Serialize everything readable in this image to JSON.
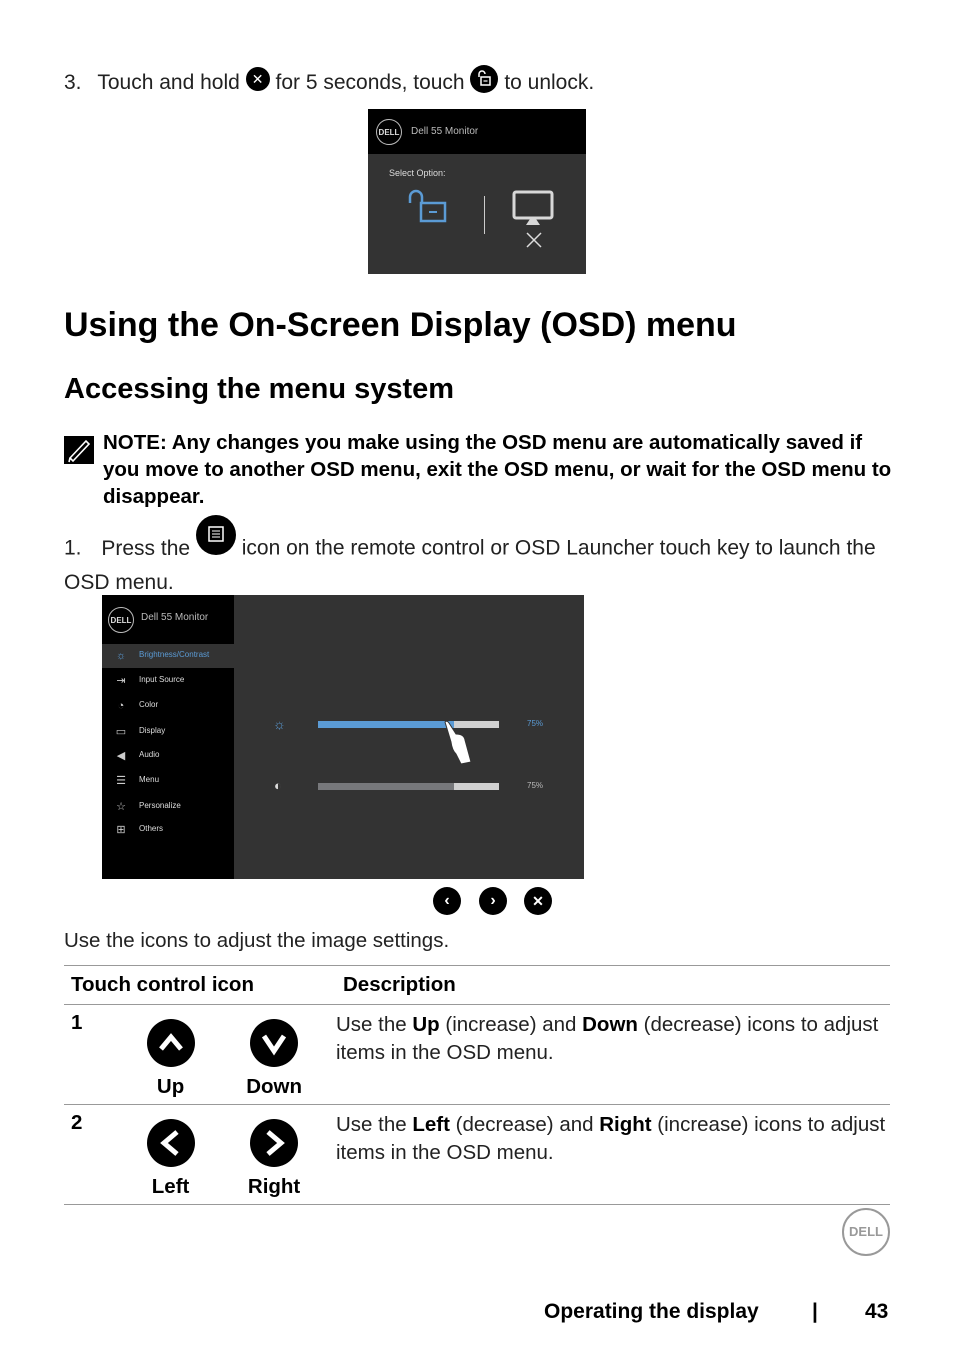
{
  "step3": {
    "number": "3.",
    "text_before": "Touch and hold",
    "text_middle": "for 5 seconds, touch",
    "text_after": "to unlock.",
    "icon1": "close-icon",
    "icon2": "unlock-icon"
  },
  "lock_dialog": {
    "logo": "DELL",
    "title": "Dell 55 Monitor",
    "prompt": "Select Option:",
    "options": [
      "unlock-icon",
      "monitor-settings-icon"
    ]
  },
  "headings": {
    "h1": "Using the On-Screen Display (OSD) menu",
    "h2": "Accessing the menu system"
  },
  "note": {
    "icon": "pencil-note-icon",
    "text": "NOTE: Any changes you make using the OSD menu are automatically saved if you move to another OSD menu, exit the OSD menu, or wait for the OSD menu to disappear."
  },
  "step1": {
    "number": "1.",
    "text_before": "Press the",
    "text_after": "icon on the remote control or OSD Launcher touch key to launch the OSD menu.",
    "icon": "menu-icon"
  },
  "osd_menu": {
    "logo": "DELL",
    "title": "Dell 55 Monitor",
    "items": [
      {
        "label": "Brightness/Contrast",
        "icon": "brightness-icon",
        "active": true
      },
      {
        "label": "Input Source",
        "icon": "input-source-icon",
        "active": false
      },
      {
        "label": "Color",
        "icon": "color-palette-icon",
        "active": false
      },
      {
        "label": "Display",
        "icon": "display-icon",
        "active": false
      },
      {
        "label": "Audio",
        "icon": "speaker-icon",
        "active": false
      },
      {
        "label": "Menu",
        "icon": "menu-icon",
        "active": false
      },
      {
        "label": "Personalize",
        "icon": "star-icon",
        "active": false
      },
      {
        "label": "Others",
        "icon": "others-icon",
        "active": false
      }
    ],
    "sliders": [
      {
        "name": "brightness",
        "icon": "brightness-icon",
        "value_pct": 75,
        "label": "75%",
        "color": "#5b9bd5"
      },
      {
        "name": "contrast",
        "icon": "contrast-icon",
        "value_pct": 75,
        "label": "75%",
        "color": "#77787b"
      }
    ],
    "nav_buttons": [
      "left-icon",
      "right-icon",
      "close-icon"
    ]
  },
  "caption": "Use the icons to adjust the image settings.",
  "table": {
    "headers": [
      "Touch control icon",
      "Description"
    ],
    "rows": [
      {
        "num": "1",
        "icons": [
          {
            "label": "Up",
            "icon": "up-icon"
          },
          {
            "label": "Down",
            "icon": "down-icon"
          }
        ],
        "desc_parts": [
          "Use the ",
          "Up",
          " (increase) and ",
          "Down",
          " (decrease) icons to adjust items in the OSD menu."
        ]
      },
      {
        "num": "2",
        "icons": [
          {
            "label": "Left",
            "icon": "left-icon"
          },
          {
            "label": "Right",
            "icon": "right-icon"
          }
        ],
        "desc_parts": [
          "Use the ",
          "Left",
          " (decrease) and ",
          "Right",
          " (increase) icons to adjust items in the OSD menu."
        ]
      }
    ]
  },
  "footer": {
    "logo": "DELL",
    "section": "Operating the display",
    "separator": "|",
    "page": "43"
  }
}
